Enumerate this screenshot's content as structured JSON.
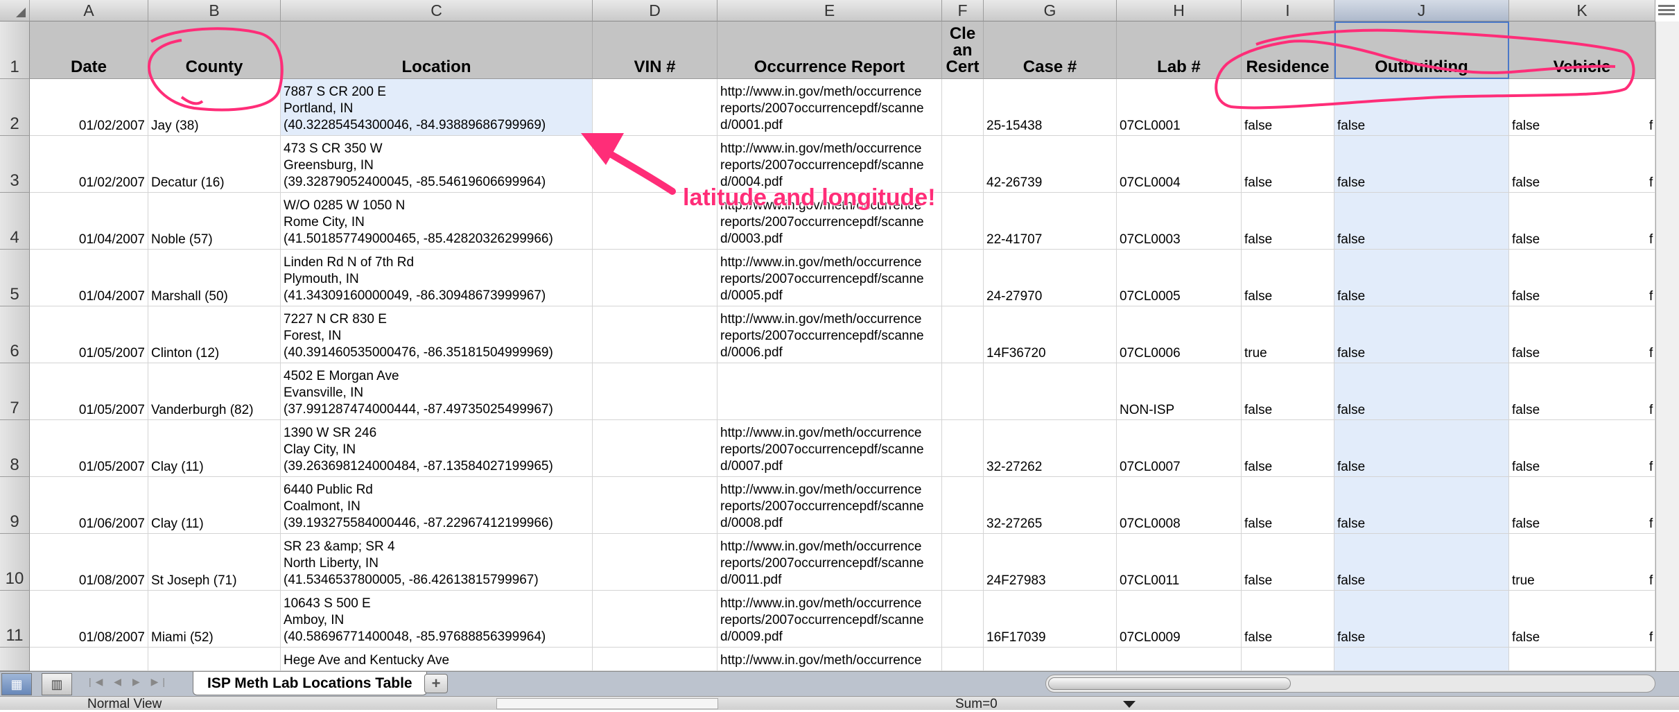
{
  "column_letters": [
    "A",
    "B",
    "C",
    "D",
    "E",
    "F",
    "G",
    "H",
    "I",
    "J",
    "K"
  ],
  "row_numbers": [
    "1",
    "2",
    "3",
    "4",
    "5",
    "6",
    "7",
    "8",
    "9",
    "10",
    "11"
  ],
  "headers": [
    "Date",
    "County",
    "Location",
    "VIN #",
    "Occurrence Report",
    "Cle\nan\nCert",
    "Case #",
    "Lab #",
    "Residence",
    "Outbuilding",
    "Vehicle"
  ],
  "rows": [
    {
      "date": "01/02/2007",
      "county": "Jay (38)",
      "location": "7887 S CR 200 E\nPortland, IN\n(40.32285454300046, -84.93889686799969)",
      "vin": "",
      "report": "http://www.in.gov/meth/occurrence\nreports/2007occurrencepdf/scanne\nd/0001.pdf",
      "cert": "",
      "case": "25-15438",
      "lab": "07CL0001",
      "residence": "false",
      "outbuilding": "false",
      "vehicle": "false",
      "extra": "f"
    },
    {
      "date": "01/02/2007",
      "county": "Decatur (16)",
      "location": "473 S CR 350 W\nGreensburg, IN\n(39.32879052400045, -85.54619606699964)",
      "vin": "",
      "report": "http://www.in.gov/meth/occurrence\nreports/2007occurrencepdf/scanne\nd/0004.pdf",
      "cert": "",
      "case": "42-26739",
      "lab": "07CL0004",
      "residence": "false",
      "outbuilding": "false",
      "vehicle": "false",
      "extra": "f"
    },
    {
      "date": "01/04/2007",
      "county": "Noble (57)",
      "location": "W/O 0285 W 1050 N\nRome City, IN\n(41.501857749000465, -85.42820326299966)",
      "vin": "",
      "report": "http://www.in.gov/meth/occurrence\nreports/2007occurrencepdf/scanne\nd/0003.pdf",
      "cert": "",
      "case": "22-41707",
      "lab": "07CL0003",
      "residence": "false",
      "outbuilding": "false",
      "vehicle": "false",
      "extra": "f"
    },
    {
      "date": "01/04/2007",
      "county": "Marshall (50)",
      "location": "Linden Rd N of 7th Rd\nPlymouth, IN\n(41.34309160000049, -86.30948673999967)",
      "vin": "",
      "report": "http://www.in.gov/meth/occurrence\nreports/2007occurrencepdf/scanne\nd/0005.pdf",
      "cert": "",
      "case": "24-27970",
      "lab": "07CL0005",
      "residence": "false",
      "outbuilding": "false",
      "vehicle": "false",
      "extra": "f"
    },
    {
      "date": "01/05/2007",
      "county": "Clinton (12)",
      "location": "7227 N CR 830 E\nForest, IN\n(40.391460535000476, -86.35181504999969)",
      "vin": "",
      "report": "http://www.in.gov/meth/occurrence\nreports/2007occurrencepdf/scanne\nd/0006.pdf",
      "cert": "",
      "case": "14F36720",
      "lab": "07CL0006",
      "residence": "true",
      "outbuilding": "false",
      "vehicle": "false",
      "extra": "f"
    },
    {
      "date": "01/05/2007",
      "county": "Vanderburgh (82)",
      "location": "4502 E Morgan Ave\nEvansville, IN\n(37.991287474000444, -87.49735025499967)",
      "vin": "",
      "report": "",
      "cert": "",
      "case": "",
      "lab": "NON-ISP",
      "residence": "false",
      "outbuilding": "false",
      "vehicle": "false",
      "extra": "f"
    },
    {
      "date": "01/05/2007",
      "county": "Clay (11)",
      "location": "1390 W SR 246\nClay City, IN\n(39.263698124000484, -87.13584027199965)",
      "vin": "",
      "report": "http://www.in.gov/meth/occurrence\nreports/2007occurrencepdf/scanne\nd/0007.pdf",
      "cert": "",
      "case": "32-27262",
      "lab": "07CL0007",
      "residence": "false",
      "outbuilding": "false",
      "vehicle": "false",
      "extra": "f"
    },
    {
      "date": "01/06/2007",
      "county": "Clay (11)",
      "location": "6440 Public Rd\nCoalmont, IN\n(39.193275584000446, -87.22967412199966)",
      "vin": "",
      "report": "http://www.in.gov/meth/occurrence\nreports/2007occurrencepdf/scanne\nd/0008.pdf",
      "cert": "",
      "case": "32-27265",
      "lab": "07CL0008",
      "residence": "false",
      "outbuilding": "false",
      "vehicle": "false",
      "extra": "f"
    },
    {
      "date": "01/08/2007",
      "county": "St Joseph (71)",
      "location": "SR 23 &amp; SR 4\nNorth Liberty, IN\n(41.5346537800005, -86.42613815799967)",
      "vin": "",
      "report": "http://www.in.gov/meth/occurrence\nreports/2007occurrencepdf/scanne\nd/0011.pdf",
      "cert": "",
      "case": "24F27983",
      "lab": "07CL0011",
      "residence": "false",
      "outbuilding": "false",
      "vehicle": "true",
      "extra": "f"
    },
    {
      "date": "01/08/2007",
      "county": "Miami (52)",
      "location": "10643 S 500 E\nAmboy, IN\n(40.58696771400048, -85.97688856399964)",
      "vin": "",
      "report": "http://www.in.gov/meth/occurrence\nreports/2007occurrencepdf/scanne\nd/0009.pdf",
      "cert": "",
      "case": "16F17039",
      "lab": "07CL0009",
      "residence": "false",
      "outbuilding": "false",
      "vehicle": "false",
      "extra": "f"
    },
    {
      "date": "",
      "county": "",
      "location": "Hege Ave and Kentucky Ave",
      "vin": "",
      "report": "http://www.in.gov/meth/occurrence",
      "cert": "",
      "case": "",
      "lab": "",
      "residence": "",
      "outbuilding": "",
      "vehicle": "",
      "extra": ""
    }
  ],
  "sheet_tab": "ISP Meth Lab Locations Table",
  "add_tab_label": "+",
  "status": {
    "view": "Normal View",
    "sum": "Sum=0"
  },
  "annotation": {
    "text": "latitude and longitude!",
    "color": "#ff2d78"
  },
  "colors": {
    "selection": "#e2ecfa",
    "header_row": "#c4c4c4",
    "annotation": "#ff2d78"
  }
}
